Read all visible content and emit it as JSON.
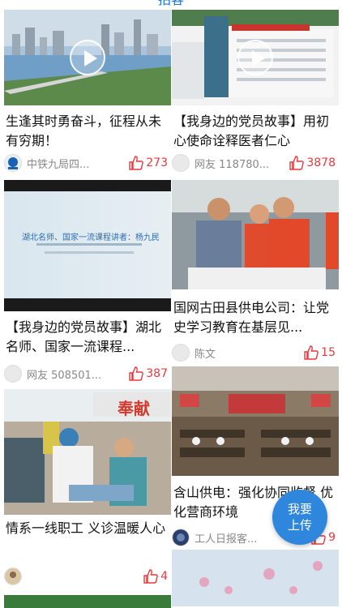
{
  "header": {
    "title": "拍客"
  },
  "left_column": [
    {
      "title": "生逢其时勇奋斗，征程从未有穷期！",
      "author": "中铁九局四...",
      "likes": "273",
      "is_video": true
    },
    {
      "title": "【我身边的党员故事】湖北名师、国家一流课程...",
      "author": "网友 508501...",
      "likes": "387",
      "is_video": false,
      "slide_heading": "湖北名师、国家一流课程讲者：杨九民"
    },
    {
      "title": "情系一线职工 义诊温暖人心",
      "author": "",
      "likes": "4",
      "is_video": false,
      "banner_text": "奉献"
    }
  ],
  "right_column": [
    {
      "title": "【我身边的党员故事】用初心使命诠释医者仁心",
      "author": "网友 118780...",
      "likes": "3878",
      "is_video": true
    },
    {
      "title": "国网古田县供电公司：让党史学习教育在基层见...",
      "author": "陈文",
      "likes": "15",
      "is_video": false
    },
    {
      "title": "含山供电：强化协同监督 优化营商环境",
      "author": "工人日报客...",
      "likes": "9",
      "is_video": false
    }
  ],
  "upload_button": {
    "line1": "我要",
    "line2": "上传"
  },
  "colors": {
    "accent": "#2f86dd",
    "like": "#e8383d"
  }
}
